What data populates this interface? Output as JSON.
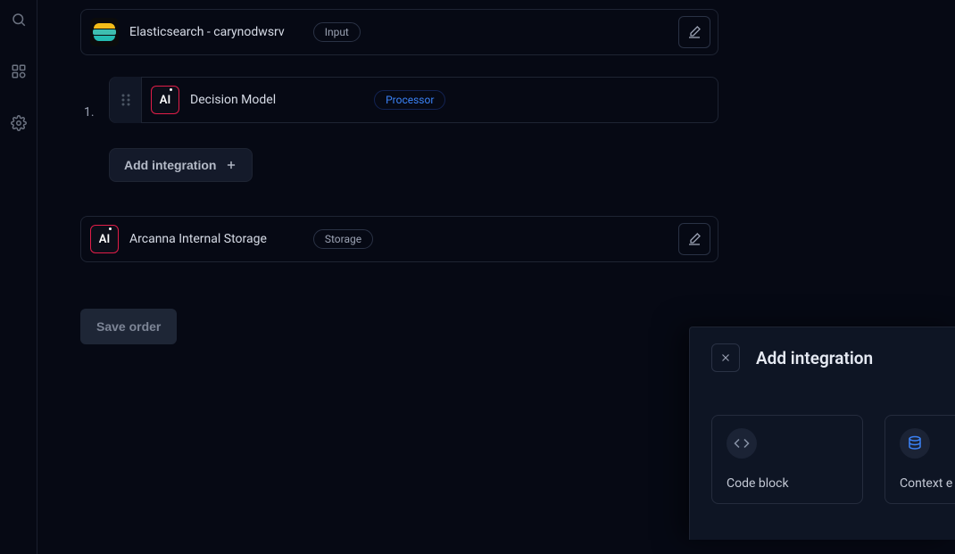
{
  "pipeline": {
    "input": {
      "title": "Elasticsearch - carynodwsrv",
      "badge": "Input"
    },
    "processors": [
      {
        "index": "1.",
        "title": "Decision Model",
        "badge": "Processor"
      }
    ],
    "storage": {
      "title": "Arcanna Internal Storage",
      "badge": "Storage"
    }
  },
  "buttons": {
    "add_integration": "Add integration",
    "save_order": "Save order"
  },
  "panel": {
    "title": "Add integration",
    "cards": {
      "code_block": "Code block",
      "context_e": "Context e"
    }
  }
}
